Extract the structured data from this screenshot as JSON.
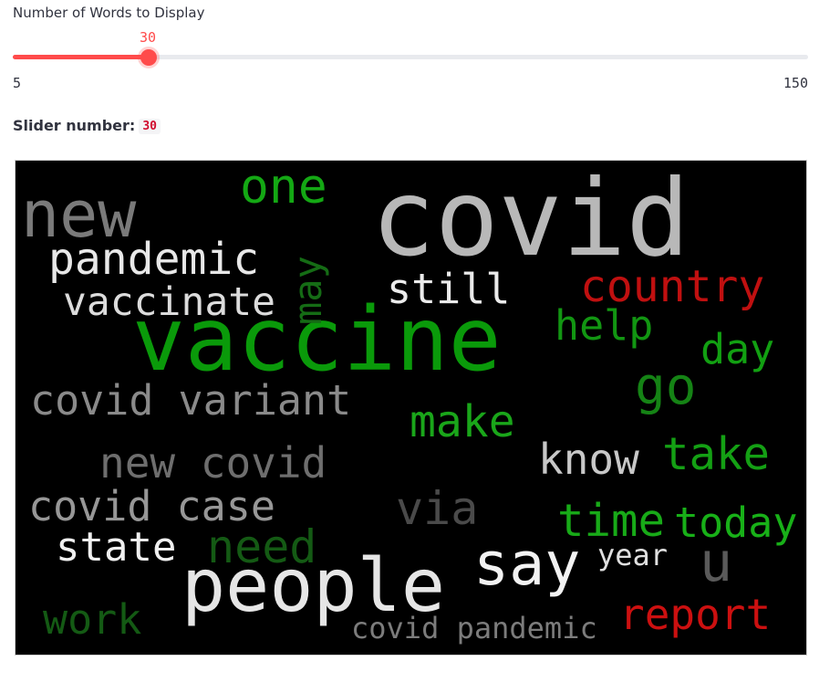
{
  "slider": {
    "label": "Number of Words to Display",
    "value": "30",
    "min": "5",
    "max": "150",
    "fill_fraction": 0.1724,
    "accent": "#ff4b4b"
  },
  "result": {
    "label": "Slider number:",
    "value": "30"
  },
  "wordcloud": {
    "background": "#000000",
    "words": [
      {
        "text": "covid",
        "color": "#b8b8b8"
      },
      {
        "text": "vaccine",
        "color": "#0a9a0a"
      },
      {
        "text": "people",
        "color": "#e6e6e6"
      },
      {
        "text": "new",
        "color": "#7a7a7a"
      },
      {
        "text": "one",
        "color": "#14a814"
      },
      {
        "text": "pandemic",
        "color": "#e8e8e8"
      },
      {
        "text": "vaccinate",
        "color": "#dcdcdc"
      },
      {
        "text": "may",
        "color": "#156c15"
      },
      {
        "text": "still",
        "color": "#ebebeb"
      },
      {
        "text": "country",
        "color": "#c01010"
      },
      {
        "text": "help",
        "color": "#129612"
      },
      {
        "text": "day",
        "color": "#12a012"
      },
      {
        "text": "go",
        "color": "#158315"
      },
      {
        "text": "covid variant",
        "color": "#8a8a8a"
      },
      {
        "text": "make",
        "color": "#1aa61a"
      },
      {
        "text": "know",
        "color": "#c8c8c8"
      },
      {
        "text": "take",
        "color": "#14a014"
      },
      {
        "text": "new covid",
        "color": "#6e6e6e"
      },
      {
        "text": "covid case",
        "color": "#979797"
      },
      {
        "text": "via",
        "color": "#4a4a4a"
      },
      {
        "text": "time",
        "color": "#18aa18"
      },
      {
        "text": "today",
        "color": "#18b018"
      },
      {
        "text": "state",
        "color": "#f0f0f0"
      },
      {
        "text": "need",
        "color": "#145a14"
      },
      {
        "text": "say",
        "color": "#f2f2f2"
      },
      {
        "text": "year",
        "color": "#e0e0e0"
      },
      {
        "text": "u",
        "color": "#5a5a5a"
      },
      {
        "text": "work",
        "color": "#145a14"
      },
      {
        "text": "covid pandemic",
        "color": "#7c7c7c"
      },
      {
        "text": "report",
        "color": "#cc1010"
      }
    ]
  }
}
